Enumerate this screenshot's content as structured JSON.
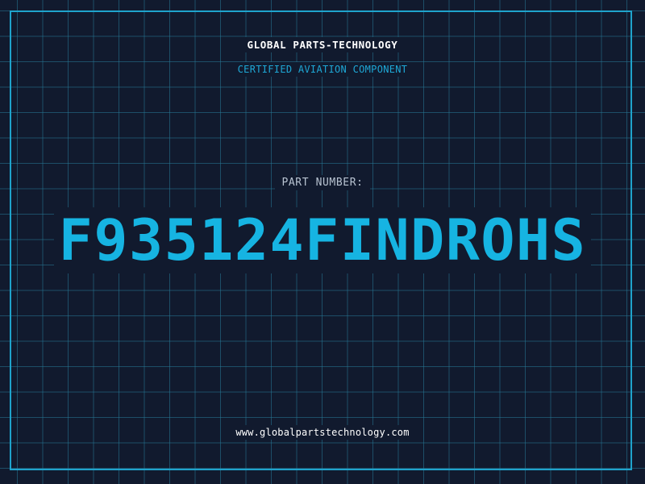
{
  "header": {
    "company_name": "GLOBAL PARTS-TECHNOLOGY",
    "subtitle": "CERTIFIED AVIATION COMPONENT"
  },
  "main": {
    "part_label": "PART NUMBER:",
    "part_number": "F935124FINDROHS"
  },
  "footer": {
    "website": "www.globalpartstechnology.com"
  },
  "colors": {
    "background": "#111a2e",
    "accent": "#16b4e2",
    "grid": "#26789a",
    "text": "#ffffff"
  }
}
